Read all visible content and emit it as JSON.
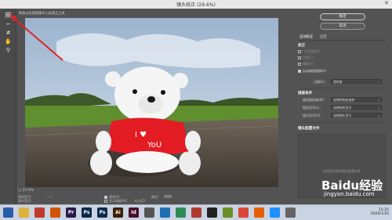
{
  "window": {
    "title": "镜头校正 (29.6%)"
  },
  "hint": "拖移以拉直图像中心处理正工具",
  "tools": [
    "remove-distortion-icon",
    "straighten-icon",
    "move-grid-icon",
    "hand-icon",
    "zoom-icon"
  ],
  "bottom": {
    "zoom": "□ 25.9%",
    "rows": [
      {
        "label": "格式类型：",
        "value": "-- ----"
      },
      {
        "label": "预览(P)",
        "value": ""
      },
      {
        "label": "显示网格(W)",
        "value": "大小(Z)"
      }
    ],
    "left_labels": [
      "相机型号：",
      "镜头型号："
    ],
    "color_label": "颜色：",
    "right_value": "-- -- --"
  },
  "buttons": {
    "ok": "确定",
    "cancel": "取消"
  },
  "tabs": [
    "自动校正",
    "自定"
  ],
  "correction": {
    "title": "校正",
    "options": [
      {
        "label": "几何扭曲(G)",
        "on": false
      },
      {
        "label": "色差(C)",
        "on": false
      },
      {
        "label": "晕影(V)",
        "on": false
      }
    ],
    "auto_scale": "自动缩放图像(A)",
    "edge_label": "边缘(E)：",
    "edge_value": "透明度"
  },
  "search": {
    "title": "搜索条件",
    "camera_make_label": "相机制造商(M)：",
    "camera_make_value": "选择相机制造商",
    "camera_model_label": "相机型号(L)：",
    "camera_model_value": "选择相机型号",
    "lens_model_label": "镜头型号(O)：",
    "lens_model_value": "选择镜头型号"
  },
  "profile": {
    "title": "镜头配置文件",
    "empty": "未找到匹配的镜头配置文件"
  },
  "watermark": {
    "logo": "Baidu经验",
    "url": "jingyan.baidu.com"
  },
  "taskbar": {
    "apps": [
      {
        "icon": "start-icon",
        "label": "",
        "color": "#2a5ca8"
      },
      {
        "icon": "folder-icon",
        "label": "",
        "color": "#e0b23c"
      },
      {
        "icon": "wps-icon",
        "label": "",
        "color": "#c0392b"
      },
      {
        "icon": "app-icon",
        "label": "",
        "color": "#d35400"
      },
      {
        "icon": "premiere-icon",
        "label": "Pr",
        "color": "#2b1a4b"
      },
      {
        "icon": "photoshop-icon",
        "label": "Ps",
        "color": "#0b2a4a"
      },
      {
        "icon": "photoshop-icon-2",
        "label": "Ps",
        "color": "#0b2a4a"
      },
      {
        "icon": "illustrator-icon",
        "label": "Ai",
        "color": "#3d1f00"
      },
      {
        "icon": "indesign-icon",
        "label": "Id",
        "color": "#4a0e2a"
      },
      {
        "icon": "app-icon",
        "label": "",
        "color": "#555"
      },
      {
        "icon": "media-icon",
        "label": "",
        "color": "#1f6fb5"
      },
      {
        "icon": "app-icon",
        "label": "",
        "color": "#2e8b57"
      },
      {
        "icon": "app-icon",
        "label": "",
        "color": "#b03a2e"
      },
      {
        "icon": "qq-icon",
        "label": "",
        "color": "#222"
      },
      {
        "icon": "app-icon",
        "label": "",
        "color": "#6b8e23"
      },
      {
        "icon": "chrome-icon",
        "label": "",
        "color": "#db4437"
      },
      {
        "icon": "firefox-icon",
        "label": "",
        "color": "#e66000"
      },
      {
        "icon": "app-icon",
        "label": "",
        "color": "#1e90ff"
      },
      {
        "icon": "app-icon",
        "label": "",
        "color": "#666"
      }
    ],
    "time": "15:25",
    "date": "2020/1/20"
  }
}
